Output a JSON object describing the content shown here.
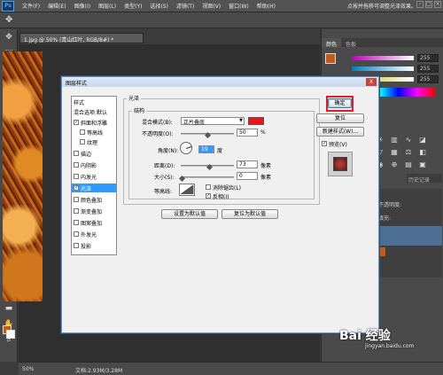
{
  "menubar": {
    "logo": "Ps",
    "items": [
      "文件(F)",
      "编辑(E)",
      "图像(I)",
      "图层(L)",
      "类型(Y)",
      "选择(S)",
      "滤镜(T)",
      "视图(V)",
      "窗口(W)",
      "帮助(H)"
    ],
    "hint": "点按并拖移可调整光泽效果。"
  },
  "document": {
    "tab": "1.jpg @ 50% (青山红叶, RGB/8#) *",
    "zoom": "50%",
    "doc_size": "文档:2.93M/3.28M"
  },
  "panels": {
    "color_tab": "颜色",
    "swatches_tab": "色板",
    "slider_values": [
      "255",
      "255",
      "255"
    ],
    "history_tab": "历史记录",
    "opacity_label": "不透明度:",
    "fill_label": "填充:"
  },
  "colors": {
    "foreground": "#c25a1b",
    "background": "#ffffff",
    "satin_color": "#e8141c",
    "selection": "#3399ff"
  },
  "dialog": {
    "title": "图层样式",
    "styles_header": "样式",
    "blend_options": "混合选项:默认",
    "style_items": [
      {
        "label": "斜面和浮雕",
        "checked": true
      },
      {
        "label": "等高线",
        "checked": false,
        "indent": true
      },
      {
        "label": "纹理",
        "checked": false,
        "indent": true
      },
      {
        "label": "描边",
        "checked": false
      },
      {
        "label": "内阴影",
        "checked": false
      },
      {
        "label": "内发光",
        "checked": false
      },
      {
        "label": "光泽",
        "checked": true,
        "selected": true
      },
      {
        "label": "颜色叠加",
        "checked": false
      },
      {
        "label": "渐变叠加",
        "checked": false
      },
      {
        "label": "图案叠加",
        "checked": false
      },
      {
        "label": "外发光",
        "checked": false
      },
      {
        "label": "投影",
        "checked": false
      }
    ],
    "section_title": "光泽",
    "structure_title": "结构",
    "blend_mode_label": "混合模式(B):",
    "blend_mode_value": "正片叠底",
    "opacity_label": "不透明度(O):",
    "opacity_value": "50",
    "opacity_unit": "%",
    "angle_label": "角度(N):",
    "angle_value": "19",
    "angle_unit": "度",
    "distance_label": "距离(D):",
    "distance_value": "73",
    "distance_unit": "像素",
    "size_label": "大小(S):",
    "size_value": "0",
    "size_unit": "像素",
    "contour_label": "等高线:",
    "antialias_label": "消除锯齿(L)",
    "invert_label": "反相(I)",
    "set_default": "设置为默认值",
    "reset_default": "复位为默认值",
    "ok": "确定",
    "reset": "复位",
    "new_style": "新建样式(W)...",
    "preview_label": "预览(V)",
    "close": "X"
  },
  "watermark": {
    "brand": "Bai 经验",
    "url": "jingyan.baidu.com"
  }
}
